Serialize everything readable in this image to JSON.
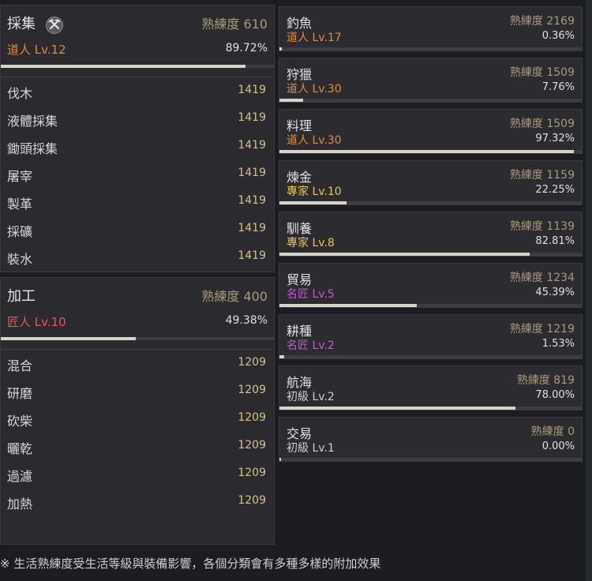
{
  "gathering": {
    "title": "採集",
    "icon": "pickaxe-icon",
    "proficiency": "熟練度 610",
    "rank": "道人 Lv.12",
    "rank_color": "#e08a3c",
    "percent": "89.72%",
    "fill": 0.8972,
    "items": [
      {
        "name": "伐木",
        "value": "1419"
      },
      {
        "name": "液體採集",
        "value": "1419"
      },
      {
        "name": "鋤頭採集",
        "value": "1419"
      },
      {
        "name": "屠宰",
        "value": "1419"
      },
      {
        "name": "製革",
        "value": "1419"
      },
      {
        "name": "採礦",
        "value": "1419"
      },
      {
        "name": "裝水",
        "value": "1419"
      }
    ]
  },
  "processing": {
    "title": "加工",
    "proficiency": "熟練度 400",
    "rank": "匠人 Lv.10",
    "rank_color": "#e05a5a",
    "percent": "49.38%",
    "fill": 0.4938,
    "items": [
      {
        "name": "混合",
        "value": "1209"
      },
      {
        "name": "研磨",
        "value": "1209"
      },
      {
        "name": "砍柴",
        "value": "1209"
      },
      {
        "name": "曬乾",
        "value": "1209"
      },
      {
        "name": "過濾",
        "value": "1209"
      },
      {
        "name": "加熱",
        "value": "1209"
      }
    ]
  },
  "skills": [
    {
      "name": "釣魚",
      "proficiency": "熟練度 2169",
      "rank": "道人 Lv.17",
      "rank_color": "#e08a3c",
      "percent": "0.36%",
      "fill": 0.0036
    },
    {
      "name": "狩獵",
      "proficiency": "熟練度 1509",
      "rank": "道人 Lv.30",
      "rank_color": "#e08a3c",
      "percent": "7.76%",
      "fill": 0.0776
    },
    {
      "name": "料理",
      "proficiency": "熟練度 1509",
      "rank": "道人 Lv.30",
      "rank_color": "#e08a3c",
      "percent": "97.32%",
      "fill": 0.9732
    },
    {
      "name": "煉金",
      "proficiency": "熟練度 1159",
      "rank": "專家 Lv.10",
      "rank_color": "#e8c64a",
      "percent": "22.25%",
      "fill": 0.2225
    },
    {
      "name": "馴養",
      "proficiency": "熟練度 1139",
      "rank": "專家 Lv.8",
      "rank_color": "#e8c64a",
      "percent": "82.81%",
      "fill": 0.8281
    },
    {
      "name": "貿易",
      "proficiency": "熟練度 1234",
      "rank": "名匠 Lv.5",
      "rank_color": "#c35ad8",
      "percent": "45.39%",
      "fill": 0.4539
    },
    {
      "name": "耕種",
      "proficiency": "熟練度 1219",
      "rank": "名匠 Lv.2",
      "rank_color": "#c35ad8",
      "percent": "1.53%",
      "fill": 0.0153
    },
    {
      "name": "航海",
      "proficiency": "熟練度 819",
      "rank": "初級 Lv.2",
      "rank_color": "#cfcfcf",
      "percent": "78.00%",
      "fill": 0.78
    },
    {
      "name": "交易",
      "proficiency": "熟練度 0",
      "rank": "初級 Lv.1",
      "rank_color": "#cfcfcf",
      "percent": "0.00%",
      "fill": 0.0
    }
  ],
  "footer": "※ 生活熟練度受生活等級與裝備影響，各個分類會有多種多樣的附加效果"
}
